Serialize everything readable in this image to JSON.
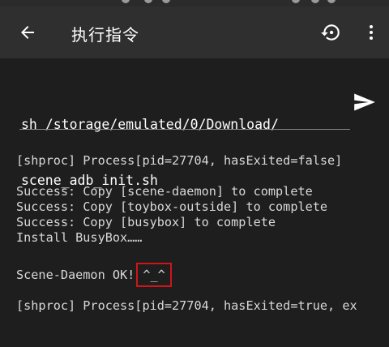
{
  "appbar": {
    "title": "执行指令",
    "icons": [
      "back-arrow-icon",
      "history-icon",
      "more-vert-icon"
    ]
  },
  "command": {
    "line1": "sh /storage/emulated/0/Download/",
    "line2": "scene_adb_init.sh",
    "send_icon": "send-icon"
  },
  "console": {
    "lines": [
      "[shproc] Process[pid=27704, hasExited=false]",
      "Success: Copy [scene-daemon] to complete",
      "Success: Copy [toybox-outside] to complete",
      "Success: Copy [busybox] to complete",
      "Install BusyBox……",
      "Scene-Daemon OK!",
      "^_^",
      "[shproc] Process[pid=27704, hasExited=true, ex"
    ]
  },
  "colors": {
    "highlight_border": "#d0141b",
    "background": "#1e1e1e",
    "appbar": "#2f2f2f"
  }
}
